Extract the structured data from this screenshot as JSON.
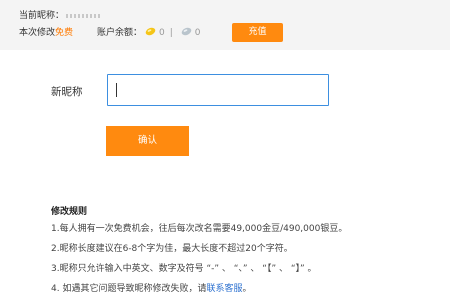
{
  "header": {
    "current_nick_label": "当前昵称：",
    "modify_prefix": "本次修改",
    "modify_free": "免费",
    "balance_label": "账户余额：",
    "gold_count": "0",
    "silver_count": "0",
    "separator": "|",
    "recharge_label": "充值",
    "icons": [
      "gold-bean-icon",
      "silver-bean-icon"
    ]
  },
  "form": {
    "nick_label": "新昵称",
    "nick_value": "",
    "confirm_label": "确认"
  },
  "rules": {
    "title": "修改规则",
    "items": [
      "1.每人拥有一次免费机会，往后每次改名需要49,000金豆/490,000银豆。",
      "2.昵称长度建议在6-8个字为佳，最大长度不超过20个字符。",
      "3.昵称只允许输入中英文、数字及符号 “-” 、 “、” 、 “【” 、 “】” 。"
    ],
    "item4_prefix": "4. 如遇其它问题导致昵称修改失败，请",
    "item4_link": "联系客服",
    "item4_suffix": "。"
  },
  "colors": {
    "accent": "#ff8a0f",
    "input_border": "#3d8fe0",
    "link": "#2a6fcf",
    "header_bg": "#f4f4f4"
  }
}
